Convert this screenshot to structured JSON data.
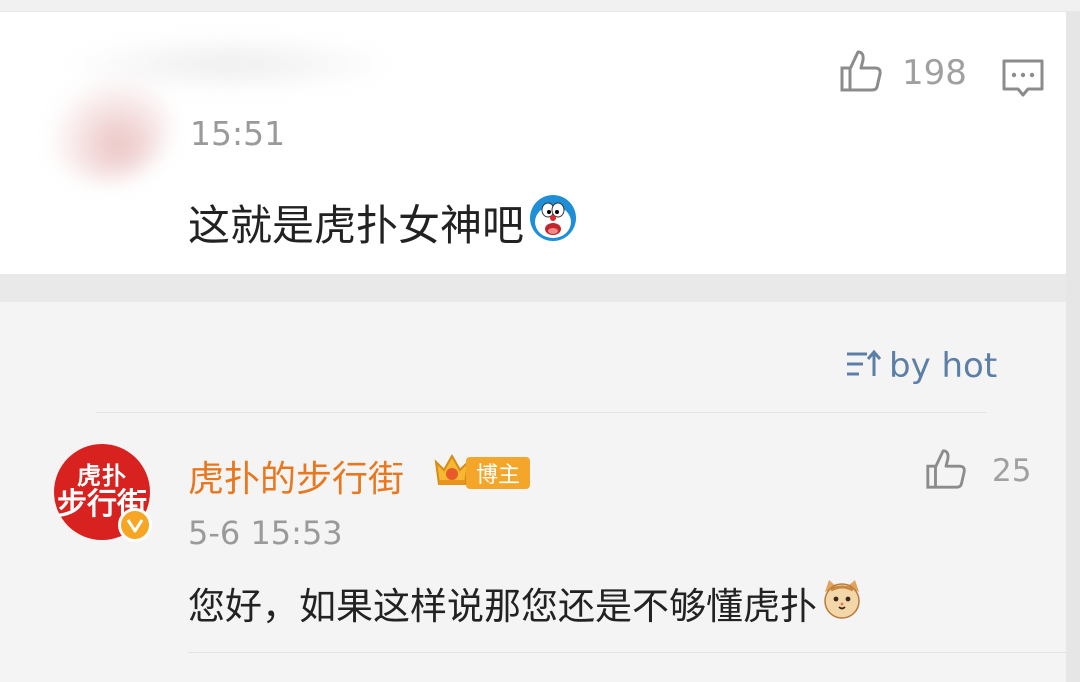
{
  "main_comment": {
    "time": "15:51",
    "text": "这就是虎扑女神吧",
    "emoji": "doraemon-emoji",
    "likes": "198",
    "like_icon": "thumbs-up-icon",
    "comment_icon": "comment-icon"
  },
  "sort": {
    "label": "by hot",
    "icon": "sort-icon"
  },
  "reply": {
    "avatar_line1": "虎扑",
    "avatar_line2": "步行街",
    "username": "虎扑的步行街",
    "badge": "博主",
    "badge_icon": "crown-icon",
    "verified_icon": "verified-icon",
    "time": "5-6 15:53",
    "text": "您好，如果这样说那您还是不够懂虎扑",
    "emoji": "cat-emoji",
    "likes": "25",
    "like_icon": "thumbs-up-icon"
  },
  "colors": {
    "username": "#e8771e",
    "sort_link": "#5b7fa6",
    "badge": "#f3a629",
    "avatar_bg": "#d8221f"
  }
}
